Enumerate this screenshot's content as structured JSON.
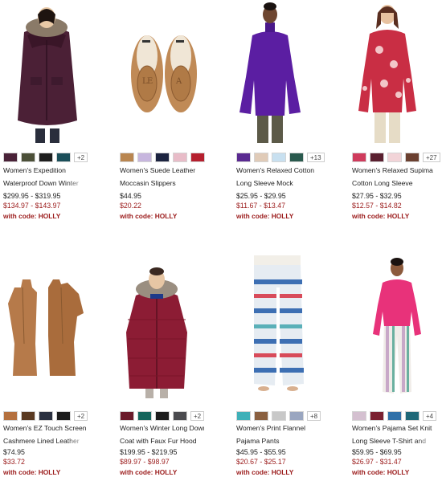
{
  "products": [
    {
      "id": "expedition",
      "name_line1": "Women's Expedition",
      "name_line2": "Waterproof Down Winter",
      "price": "$299.95 - $319.95",
      "sale": "$134.97 - $143.97",
      "promo": "with code: HOLLY",
      "swatches": [
        "#4a2238",
        "#4c5038",
        "#1e1e1e",
        "#1b4f5a"
      ],
      "more": "+2"
    },
    {
      "id": "moccasin",
      "name_line1": "Women's Suede Leather",
      "name_line2": "Moccasin Slippers",
      "price": "$44.95",
      "sale": "$20.22",
      "promo": "with code: HOLLY",
      "swatches": [
        "#b98650",
        "#c7b6de",
        "#1c2440",
        "#e8bcc8",
        "#b51f2e"
      ],
      "more": ""
    },
    {
      "id": "mock",
      "name_line1": "Women's Relaxed Cotton",
      "name_line2": "Long Sleeve Mock",
      "price": "$25.95 - $29.95",
      "sale": "$11.67 - $13.47",
      "promo": "with code: HOLLY",
      "swatches": [
        "#5a2a91",
        "#e0cbb8",
        "#c8e0f0",
        "#2a5a4e"
      ],
      "more": "+13"
    },
    {
      "id": "supima",
      "name_line1": "Women's Relaxed Supima",
      "name_line2": "Cotton Long Sleeve",
      "price": "$27.95 - $32.95",
      "sale": "$12.57 - $14.82",
      "promo": "with code: HOLLY",
      "swatches": [
        "#cf3b5c",
        "#5a2030",
        "#f2d4d8",
        "#6b4030"
      ],
      "more": "+27"
    },
    {
      "id": "gloves",
      "name_line1": "Women's EZ Touch Screen",
      "name_line2": "Cashmere Lined Leather",
      "price": "$74.95",
      "sale": "$33.72",
      "promo": "with code: HOLLY",
      "swatches": [
        "#b4703e",
        "#5a3a22",
        "#2a3040",
        "#1c1c1c"
      ],
      "more": "+2"
    },
    {
      "id": "longdown",
      "name_line1": "Women's Winter Long Down",
      "name_line2": "Coat with Faux Fur Hood",
      "price": "$199.95 - $219.95",
      "sale": "$89.97 - $98.97",
      "promo": "with code: HOLLY",
      "swatches": [
        "#6a1a2a",
        "#15655c",
        "#1c1c1c",
        "#4a4a4e"
      ],
      "more": "+2"
    },
    {
      "id": "flannel",
      "name_line1": "Women's Print Flannel",
      "name_line2": "Pajama Pants",
      "price": "$45.95 - $55.95",
      "sale": "$20.67 - $25.17",
      "promo": "with code: HOLLY",
      "swatches": [
        "#3fb0b8",
        "#8a6040",
        "#c8c8c8",
        "#9aa6c0"
      ],
      "more": "+8"
    },
    {
      "id": "pajamaset",
      "name_line1": "Women's Pajama Set Knit",
      "name_line2": "Long Sleeve T-Shirt and",
      "price": "$59.95 - $69.95",
      "sale": "$26.97 - $31.47",
      "promo": "with code: HOLLY",
      "swatches": [
        "#d4c0d0",
        "#7a2030",
        "#3070a8",
        "#206878"
      ],
      "more": "+4"
    }
  ]
}
